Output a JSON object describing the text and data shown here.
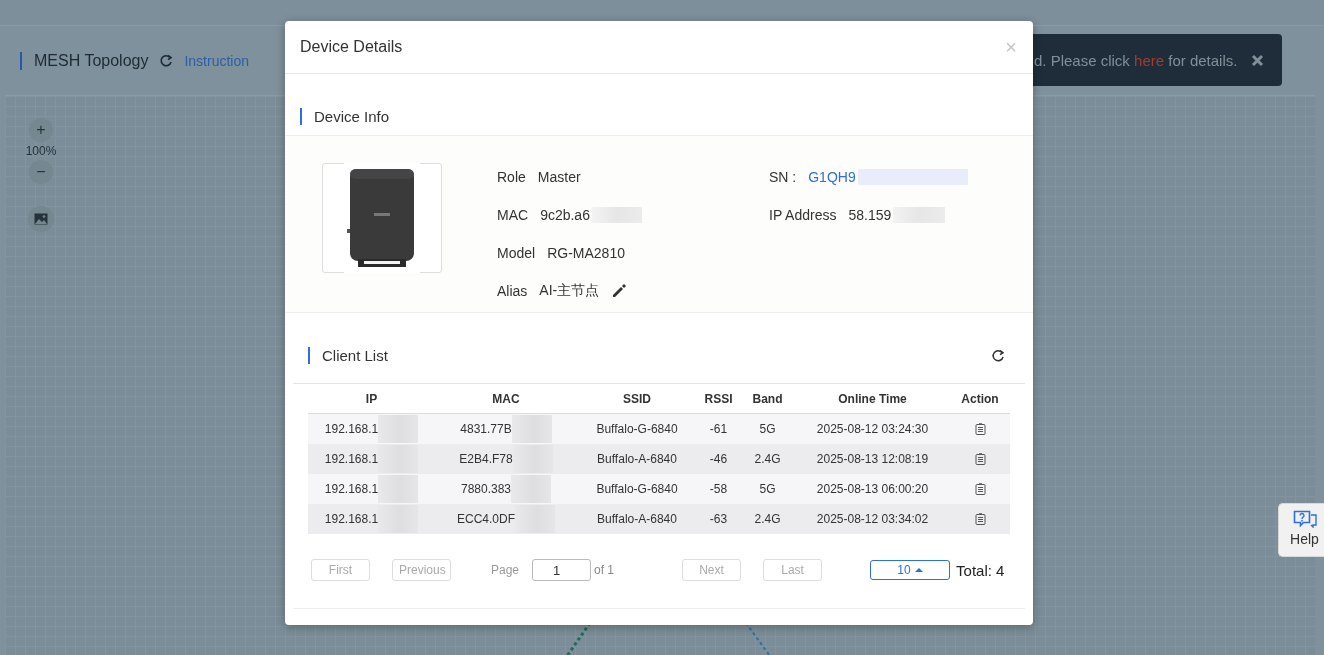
{
  "background": {
    "title": "MESH Topology",
    "instruction": "Instruction",
    "zoom": {
      "zoom_in": "+",
      "level": "100%",
      "zoom_out": "−"
    }
  },
  "notification": {
    "before": "d. Please click ",
    "link": "here",
    "after": " for details."
  },
  "help": {
    "label": "Help"
  },
  "dialog": {
    "title": "Device Details",
    "close": "×",
    "device_info": {
      "heading": "Device Info",
      "left": [
        {
          "label": "Role",
          "value": "Master",
          "kind": "text",
          "blurred": false
        },
        {
          "label": "MAC",
          "value": "9c2b.a6",
          "kind": "text",
          "blurred": true
        },
        {
          "label": "Model",
          "value": "RG-MA2810",
          "kind": "text",
          "blurred": false
        },
        {
          "label": "Alias",
          "value": "AI-主节点",
          "kind": "editable",
          "blurred": false
        }
      ],
      "right": [
        {
          "label": "SN :",
          "value": "G1QH9",
          "kind": "link",
          "blurred": true
        },
        {
          "label": "IP Address",
          "value": "58.159",
          "kind": "text",
          "blurred": true
        }
      ]
    },
    "client_list": {
      "heading": "Client List",
      "columns": [
        "IP",
        "MAC",
        "SSID",
        "RSSI",
        "Band",
        "Online Time",
        "Action"
      ],
      "rows": [
        {
          "cells": [
            {
              "text": "192.168.1",
              "blurred": true
            },
            {
              "text": "4831.77B",
              "blurred": true
            },
            {
              "text": "Buffalo-G-6840",
              "blurred": false
            },
            {
              "text": "-61",
              "blurred": false
            },
            {
              "text": "5G",
              "blurred": false
            },
            {
              "text": "2025-08-12 03:24:30",
              "blurred": false
            }
          ]
        },
        {
          "cells": [
            {
              "text": "192.168.1",
              "blurred": true
            },
            {
              "text": "E2B4.F78",
              "blurred": true
            },
            {
              "text": "Buffalo-A-6840",
              "blurred": false
            },
            {
              "text": "-46",
              "blurred": false
            },
            {
              "text": "2.4G",
              "blurred": false
            },
            {
              "text": "2025-08-13 12:08:19",
              "blurred": false
            }
          ]
        },
        {
          "cells": [
            {
              "text": "192.168.1",
              "blurred": true
            },
            {
              "text": "7880.383",
              "blurred": true
            },
            {
              "text": "Buffalo-G-6840",
              "blurred": false
            },
            {
              "text": "-58",
              "blurred": false
            },
            {
              "text": "5G",
              "blurred": false
            },
            {
              "text": "2025-08-13 06:00:20",
              "blurred": false
            }
          ]
        },
        {
          "cells": [
            {
              "text": "192.168.1",
              "blurred": true
            },
            {
              "text": "ECC4.0DF",
              "blurred": true
            },
            {
              "text": "Buffalo-A-6840",
              "blurred": false
            },
            {
              "text": "-63",
              "blurred": false
            },
            {
              "text": "2.4G",
              "blurred": false
            },
            {
              "text": "2025-08-12 03:34:02",
              "blurred": false
            }
          ]
        }
      ],
      "pagination": {
        "first": {
          "label": "First",
          "disabled": true
        },
        "previous": {
          "label": "Previous",
          "disabled": true
        },
        "page_label": "Page",
        "page_value": "1",
        "of": "of 1",
        "next": {
          "label": "Next",
          "disabled": true
        },
        "last": {
          "label": "Last",
          "disabled": true
        },
        "page_size": "10",
        "total": "Total: 4"
      }
    }
  }
}
